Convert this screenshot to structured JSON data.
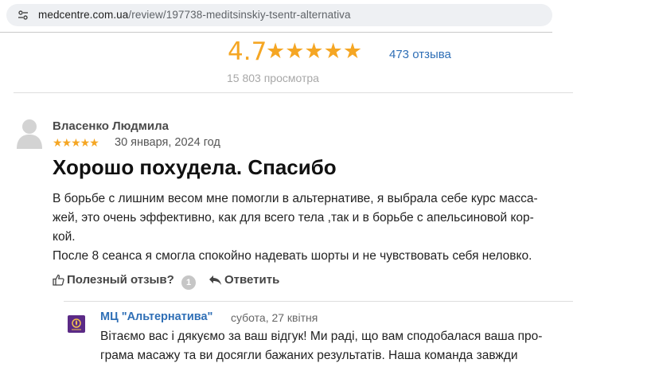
{
  "browser": {
    "url_domain": "medcentre.com.ua",
    "url_path": "/review/197738-meditsinskiy-tsentr-alternativa"
  },
  "summary": {
    "rating": "4.7",
    "stars": "★★★★★",
    "reviews_count": "473 отзыва",
    "views": "15 803 просмотра",
    "star_color": "#f5a623"
  },
  "review": {
    "author": "Власенко Людмила",
    "stars": "★★★★★",
    "rating_value": 5,
    "date": "30 января, 2024 год",
    "title": "Хорошо похудела. Спасибо",
    "body_lines": [
      "В борьбе с лишним весом мне помогли в альтернативе, я выбрала себе курс масса-",
      "жей, это очень эффективно, как для всего тела ,так и в борьбе с апельсиновой кор-",
      "кой.",
      "После 8 сеанса я смогла спокойно надевать шорты и не чувствовать себя неловко."
    ],
    "helpful_label": "Полезный отзыв?",
    "helpful_count": "1",
    "reply_label": "Ответить"
  },
  "reply": {
    "author": "МЦ \"Альтернатива\"",
    "date": "субота, 27 квітня",
    "body_lines": [
      "Вітаємо вас і дякуємо за ваш відгук! Ми раді, що вам сподобалася ваша про-",
      "грама масажу та ви досягли бажаних результатів. Наша команда завжди"
    ]
  }
}
